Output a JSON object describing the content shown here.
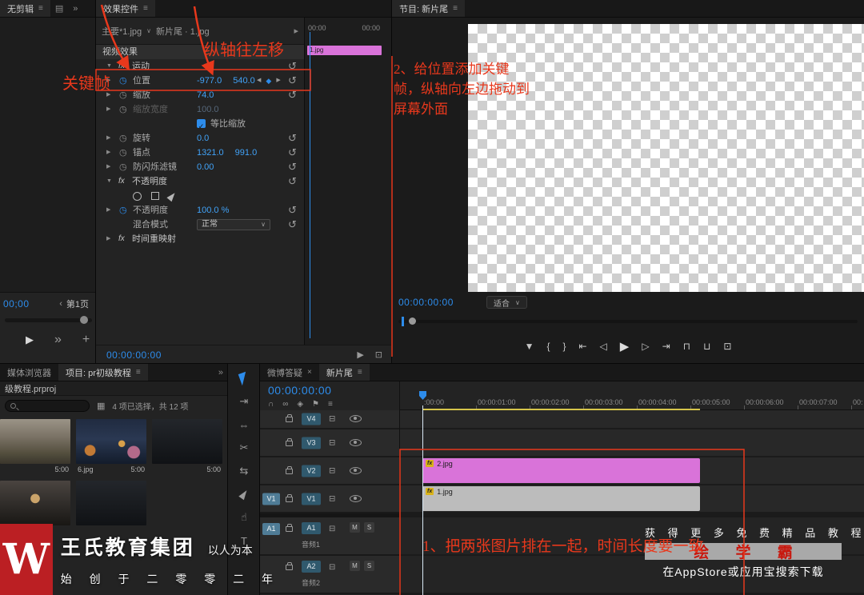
{
  "colors": {
    "accent": "#2d8ceb",
    "value-blue": "#41a2f7",
    "clip-pink": "#d973d9",
    "clip-gray": "#bcbcbc",
    "red": "#e8381c",
    "badge": "#30596d",
    "badge-light": "#4f7c96",
    "fx-yellow": "#d9b31a",
    "work-yellow": "#d6c54a"
  },
  "source_monitor": {
    "tab_label": "无剪辑",
    "tab_menu": "≡",
    "panel_icon": "▤",
    "overflow_icon": "»",
    "timecode": "00;00",
    "page_nav_icon": "‹",
    "page_label": "第1页",
    "play_icon": "▶",
    "chevrons_icon": "»",
    "plus_icon": "+"
  },
  "effect_controls": {
    "tab_label": "效果控件",
    "tab_menu": "≡",
    "source_label": "主要*1.jpg",
    "source_caret": "∨",
    "clip_ref": "新片尾 · 1.jpg",
    "pin_icon": "▸",
    "ruler_start": "00:00",
    "ruler_end": "00:00",
    "clip_bar_label": "1.jpg",
    "rows": [
      {
        "kind": "section",
        "label": "视频效果"
      },
      {
        "kind": "group",
        "label": "运动",
        "reset": true
      },
      {
        "kind": "prop",
        "label": "位置",
        "values": [
          "-977.0",
          "540.0"
        ],
        "stopwatch": "on",
        "nav": true,
        "reset": true
      },
      {
        "kind": "prop",
        "label": "缩放",
        "values": [
          "74.0"
        ],
        "stopwatch": "off",
        "reset": true
      },
      {
        "kind": "prop",
        "label": "缩放宽度",
        "values": [
          "100.0"
        ],
        "stopwatch": "off",
        "disabled": true
      },
      {
        "kind": "check",
        "label": "等比缩放",
        "checked": true
      },
      {
        "kind": "prop",
        "label": "旋转",
        "values": [
          "0.0"
        ],
        "stopwatch": "off",
        "reset": true
      },
      {
        "kind": "prop",
        "label": "锚点",
        "values": [
          "1321.0",
          "991.0"
        ],
        "stopwatch": "off",
        "reset": true
      },
      {
        "kind": "prop",
        "label": "防闪烁滤镜",
        "values": [
          "0.00"
        ],
        "stopwatch": "off",
        "reset": true
      },
      {
        "kind": "group",
        "label": "不透明度",
        "reset": true
      },
      {
        "kind": "shapes"
      },
      {
        "kind": "prop",
        "label": "不透明度",
        "values": [
          "100.0 %"
        ],
        "stopwatch": "on",
        "reset": true
      },
      {
        "kind": "dropdown",
        "label": "混合模式",
        "value": "正常",
        "reset": true
      },
      {
        "kind": "group",
        "label": "时间重映射",
        "collapsed": true
      }
    ],
    "footer_timecode": "00:00:00:00",
    "footer_icons": [
      {
        "name": "play-audio-button",
        "glyph": "▶"
      },
      {
        "name": "toggle-view-button",
        "glyph": "⊡"
      }
    ]
  },
  "program_monitor": {
    "tab_label": "节目: 新片尾",
    "tab_menu": "≡",
    "timecode": "00:00:00:00",
    "fit_label": "适合",
    "fit_caret": "∨",
    "transport": [
      {
        "name": "add-marker-button",
        "glyph": "▼"
      },
      {
        "name": "mark-in-button",
        "glyph": "{"
      },
      {
        "name": "mark-out-button",
        "glyph": "}"
      },
      {
        "name": "go-to-in-button",
        "glyph": "⇤"
      },
      {
        "name": "step-back-button",
        "glyph": "◁"
      },
      {
        "name": "play-button",
        "glyph": "▶"
      },
      {
        "name": "step-forward-button",
        "glyph": "▷"
      },
      {
        "name": "go-to-out-button",
        "glyph": "⇥"
      },
      {
        "name": "lift-button",
        "glyph": "⊓"
      },
      {
        "name": "extract-button",
        "glyph": "⊔"
      },
      {
        "name": "export-frame-button",
        "glyph": "⊡"
      }
    ]
  },
  "project_panel": {
    "tab_media": "媒体浏览器",
    "tab_project": "项目: pr初级教程",
    "tab_menu": "≡",
    "overflow_icon": "»",
    "project_item": "级教程.prproj",
    "list_view_icon": "▦",
    "status_text": "4 项已选择，共 12 项",
    "items": [
      {
        "name": "",
        "duration": "5:00",
        "thumb": "people"
      },
      {
        "name": "6.jpg",
        "duration": "5:00",
        "thumb": "night"
      },
      {
        "name": "",
        "duration": "5:00",
        "thumb": "dark"
      },
      {
        "name": "",
        "duration": "",
        "thumb": "street"
      },
      {
        "name": "",
        "duration": "",
        "thumb": "dark"
      }
    ]
  },
  "tools": [
    {
      "name": "selection-tool",
      "shape": "cursor",
      "glyph": "",
      "active": true
    },
    {
      "name": "track-select-forward-tool",
      "glyph": "⇥"
    },
    {
      "name": "ripple-edit-tool",
      "glyph": "⇔"
    },
    {
      "name": "razor-tool",
      "glyph": "✂"
    },
    {
      "name": "slip-tool",
      "glyph": "⇆"
    },
    {
      "name": "pen-tool",
      "shape": "pen",
      "glyph": ""
    },
    {
      "name": "hand-tool",
      "glyph": "☝"
    },
    {
      "name": "type-tool",
      "glyph": "T"
    }
  ],
  "timeline": {
    "tab1_label": "微博答疑",
    "tab1_close": "×",
    "tab2_label": "新片尾",
    "tab2_menu": "≡",
    "timecode": "00:00:00:00",
    "toolbar": [
      {
        "name": "snap-icon",
        "glyph": "∩"
      },
      {
        "name": "linked-selection-icon",
        "glyph": "∞"
      },
      {
        "name": "add-marker-icon",
        "glyph": "◈"
      },
      {
        "name": "marker-icon",
        "glyph": "⚑"
      },
      {
        "name": "timeline-settings-icon",
        "glyph": "≡"
      }
    ],
    "ruler_labels": [
      ":00:00",
      "00:00:01:00",
      "00:00:02:00",
      "00:00:03:00",
      "00:00:04:00",
      "00:00:05:00",
      "00:00:06:00",
      "00:00:07:00",
      "00:"
    ],
    "sync_icon": "⊟",
    "video_tracks": [
      {
        "name": "V4",
        "height": 22
      },
      {
        "name": "V3",
        "height": 33
      },
      {
        "name": "V2",
        "height": 33,
        "clip": {
          "label": "2.jpg",
          "color": "pink"
        }
      },
      {
        "name": "V1",
        "height": 33,
        "patch": "V1",
        "clip": {
          "label": "1.jpg",
          "color": "gray"
        }
      }
    ],
    "audio_tracks": [
      {
        "name": "A1",
        "patch": "A1",
        "track_label": "音频1"
      },
      {
        "name": "A2",
        "track_label": "音频2"
      }
    ],
    "mute_label": "M",
    "solo_label": "S"
  },
  "brand": {
    "logo_letter": "W",
    "name": "王氏教育集团",
    "slogan": "以人为本",
    "line2": "始 创 于 二 零 零 二 年"
  },
  "ad": {
    "line1": "获 得 更 多 免 费 精 品 教 程",
    "line2": "绘 学 霸",
    "line3": "在AppStore或应用宝搜索下载"
  },
  "annotations": {
    "keyframe_label": "关键帧",
    "axis_label": "纵轴往左移",
    "note_position": "2、给位置添加关键帧，纵轴向左边拖动到屏幕外面",
    "note_arrange": "1、把两张图片排在一起，时间长度要一致"
  }
}
